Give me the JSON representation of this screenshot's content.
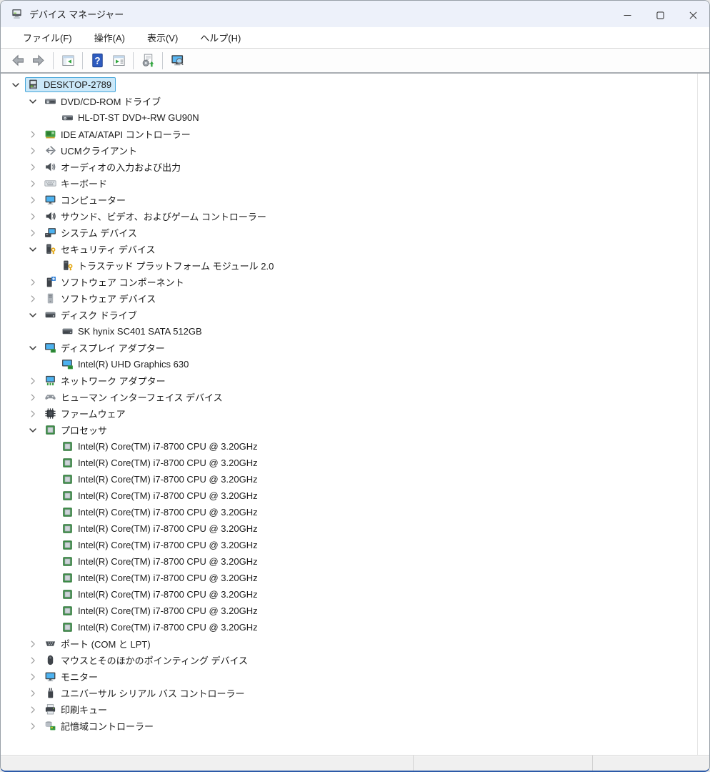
{
  "window": {
    "title": "デバイス マネージャー",
    "controls": [
      {
        "id": "minimize",
        "name": "minimize-button"
      },
      {
        "id": "maximize",
        "name": "maximize-button"
      },
      {
        "id": "close",
        "name": "close-button"
      }
    ]
  },
  "menu_bar": {
    "items": [
      {
        "id": "file",
        "label": "ファイル(F)"
      },
      {
        "id": "action",
        "label": "操作(A)"
      },
      {
        "id": "view",
        "label": "表示(V)"
      },
      {
        "id": "help",
        "label": "ヘルプ(H)"
      }
    ]
  },
  "toolbar": {
    "items": [
      {
        "type": "button",
        "icon": "back-icon"
      },
      {
        "type": "button",
        "icon": "forward-icon"
      },
      {
        "type": "separator"
      },
      {
        "type": "button",
        "icon": "show-console-tree-icon"
      },
      {
        "type": "separator"
      },
      {
        "type": "button",
        "icon": "help-icon"
      },
      {
        "type": "button",
        "icon": "properties-icon"
      },
      {
        "type": "separator"
      },
      {
        "type": "button",
        "icon": "update-driver-icon"
      },
      {
        "type": "separator"
      },
      {
        "type": "button",
        "icon": "scan-hardware-changes-icon"
      }
    ]
  },
  "tree": {
    "rows": [
      {
        "id": "desktop-2789",
        "level": 0,
        "expander": "expanded",
        "icon": "desktop-computer-icon",
        "label": "DESKTOP-2789",
        "selected": true
      },
      {
        "id": "dvd-cd-rom-drives",
        "level": 1,
        "expander": "expanded",
        "icon": "dvd-drive-icon",
        "label": "DVD/CD-ROM ドライブ"
      },
      {
        "id": "hl-dt-st-dvd-rw-gu90n",
        "level": 2,
        "expander": "none",
        "icon": "dvd-drive-icon",
        "label": "HL-DT-ST DVD+-RW GU90N"
      },
      {
        "id": "ide-ata-atapi-controllers",
        "level": 1,
        "expander": "collapsed",
        "icon": "ide-controller-icon",
        "label": "IDE ATA/ATAPI コントローラー"
      },
      {
        "id": "ucm-clients",
        "level": 1,
        "expander": "collapsed",
        "icon": "ucm-client-icon",
        "label": "UCMクライアント"
      },
      {
        "id": "audio-inputs-outputs",
        "level": 1,
        "expander": "collapsed",
        "icon": "audio-endpoint-icon",
        "label": "オーディオの入力および出力"
      },
      {
        "id": "keyboards",
        "level": 1,
        "expander": "collapsed",
        "icon": "keyboard-icon",
        "label": "キーボード"
      },
      {
        "id": "computer",
        "level": 1,
        "expander": "collapsed",
        "icon": "monitor-icon",
        "label": "コンピューター"
      },
      {
        "id": "sound-video-game",
        "level": 1,
        "expander": "collapsed",
        "icon": "speaker-icon",
        "label": "サウンド、ビデオ、およびゲーム コントローラー"
      },
      {
        "id": "system-devices",
        "level": 1,
        "expander": "collapsed",
        "icon": "system-device-icon",
        "label": "システム デバイス"
      },
      {
        "id": "security-devices",
        "level": 1,
        "expander": "expanded",
        "icon": "security-device-icon",
        "label": "セキュリティ デバイス"
      },
      {
        "id": "tpm-2-0",
        "level": 2,
        "expander": "none",
        "icon": "security-device-icon",
        "label": "トラステッド プラットフォーム モジュール 2.0"
      },
      {
        "id": "software-components",
        "level": 1,
        "expander": "collapsed",
        "icon": "software-component-icon",
        "label": "ソフトウェア コンポーネント"
      },
      {
        "id": "software-devices",
        "level": 1,
        "expander": "collapsed",
        "icon": "software-device-icon",
        "label": "ソフトウェア デバイス"
      },
      {
        "id": "disk-drives",
        "level": 1,
        "expander": "expanded",
        "icon": "disk-drive-icon",
        "label": "ディスク ドライブ"
      },
      {
        "id": "sk-hynix-sc401",
        "level": 2,
        "expander": "none",
        "icon": "disk-drive-icon",
        "label": "SK hynix SC401 SATA 512GB"
      },
      {
        "id": "display-adapters",
        "level": 1,
        "expander": "expanded",
        "icon": "display-adapter-icon",
        "label": "ディスプレイ アダプター"
      },
      {
        "id": "intel-uhd-graphics-630",
        "level": 2,
        "expander": "none",
        "icon": "display-adapter-icon",
        "label": "Intel(R) UHD Graphics 630"
      },
      {
        "id": "network-adapters",
        "level": 1,
        "expander": "collapsed",
        "icon": "network-adapter-icon",
        "label": "ネットワーク アダプター"
      },
      {
        "id": "human-interface-devices",
        "level": 1,
        "expander": "collapsed",
        "icon": "hid-icon",
        "label": "ヒューマン インターフェイス デバイス"
      },
      {
        "id": "firmware",
        "level": 1,
        "expander": "collapsed",
        "icon": "firmware-chip-icon",
        "label": "ファームウェア"
      },
      {
        "id": "processors",
        "level": 1,
        "expander": "expanded",
        "icon": "processor-icon",
        "label": "プロセッサ"
      },
      {
        "id": "cpu-0",
        "level": 2,
        "expander": "none",
        "icon": "processor-icon",
        "label": "Intel(R) Core(TM) i7-8700 CPU @ 3.20GHz"
      },
      {
        "id": "cpu-1",
        "level": 2,
        "expander": "none",
        "icon": "processor-icon",
        "label": "Intel(R) Core(TM) i7-8700 CPU @ 3.20GHz"
      },
      {
        "id": "cpu-2",
        "level": 2,
        "expander": "none",
        "icon": "processor-icon",
        "label": "Intel(R) Core(TM) i7-8700 CPU @ 3.20GHz"
      },
      {
        "id": "cpu-3",
        "level": 2,
        "expander": "none",
        "icon": "processor-icon",
        "label": "Intel(R) Core(TM) i7-8700 CPU @ 3.20GHz"
      },
      {
        "id": "cpu-4",
        "level": 2,
        "expander": "none",
        "icon": "processor-icon",
        "label": "Intel(R) Core(TM) i7-8700 CPU @ 3.20GHz"
      },
      {
        "id": "cpu-5",
        "level": 2,
        "expander": "none",
        "icon": "processor-icon",
        "label": "Intel(R) Core(TM) i7-8700 CPU @ 3.20GHz"
      },
      {
        "id": "cpu-6",
        "level": 2,
        "expander": "none",
        "icon": "processor-icon",
        "label": "Intel(R) Core(TM) i7-8700 CPU @ 3.20GHz"
      },
      {
        "id": "cpu-7",
        "level": 2,
        "expander": "none",
        "icon": "processor-icon",
        "label": "Intel(R) Core(TM) i7-8700 CPU @ 3.20GHz"
      },
      {
        "id": "cpu-8",
        "level": 2,
        "expander": "none",
        "icon": "processor-icon",
        "label": "Intel(R) Core(TM) i7-8700 CPU @ 3.20GHz"
      },
      {
        "id": "cpu-9",
        "level": 2,
        "expander": "none",
        "icon": "processor-icon",
        "label": "Intel(R) Core(TM) i7-8700 CPU @ 3.20GHz"
      },
      {
        "id": "cpu-10",
        "level": 2,
        "expander": "none",
        "icon": "processor-icon",
        "label": "Intel(R) Core(TM) i7-8700 CPU @ 3.20GHz"
      },
      {
        "id": "cpu-11",
        "level": 2,
        "expander": "none",
        "icon": "processor-icon",
        "label": "Intel(R) Core(TM) i7-8700 CPU @ 3.20GHz"
      },
      {
        "id": "ports-com-lpt",
        "level": 1,
        "expander": "collapsed",
        "icon": "serial-port-icon",
        "label": "ポート (COM と LPT)"
      },
      {
        "id": "mice-pointing-devices",
        "level": 1,
        "expander": "collapsed",
        "icon": "mouse-icon",
        "label": "マウスとそのほかのポインティング デバイス"
      },
      {
        "id": "monitors",
        "level": 1,
        "expander": "collapsed",
        "icon": "monitor-icon",
        "label": "モニター"
      },
      {
        "id": "usb-controllers",
        "level": 1,
        "expander": "collapsed",
        "icon": "usb-plug-icon",
        "label": "ユニバーサル シリアル バス コントローラー"
      },
      {
        "id": "print-queues",
        "level": 1,
        "expander": "collapsed",
        "icon": "printer-icon",
        "label": "印刷キュー"
      },
      {
        "id": "storage-controllers",
        "level": 1,
        "expander": "collapsed",
        "icon": "storage-controller-icon",
        "label": "記憶域コントローラー"
      }
    ]
  },
  "status_bar": {
    "segments": [
      "",
      "",
      ""
    ]
  },
  "colors": {
    "titlebar_bg": "#edf1fa",
    "selection_bg": "#cbe8f9",
    "selection_border": "#46a6d9",
    "window_bottom_border": "#2c5aa8"
  }
}
